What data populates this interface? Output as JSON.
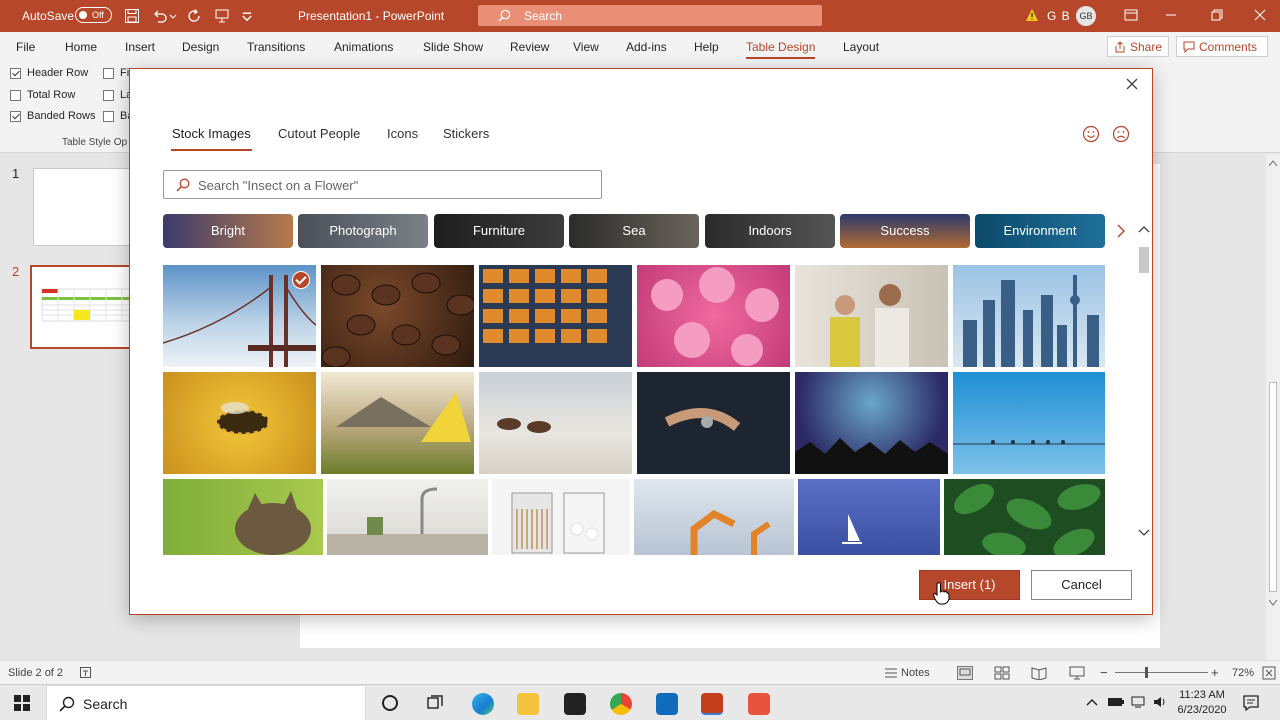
{
  "titlebar": {
    "autosave_label": "AutoSave",
    "autosave_state": "Off",
    "doc_title": "Presentation1 - PowerPoint",
    "search_placeholder": "Search",
    "user_initials": "G B",
    "avatar_initials": "GB"
  },
  "ribbon_tabs": [
    "File",
    "Home",
    "Insert",
    "Design",
    "Transitions",
    "Animations",
    "Slide Show",
    "Review",
    "View",
    "Add-ins",
    "Help",
    "Table Design",
    "Layout"
  ],
  "active_ribbon_tab": "Table Design",
  "share_label": "Share",
  "comments_label": "Comments",
  "table_style_options": {
    "header_row": "Header Row",
    "total_row": "Total Row",
    "banded_rows": "Banded Rows",
    "first_col_partial": "Fi",
    "last_col_partial": "La",
    "banded_col_partial": "Ba",
    "group_label": "Table Style Op"
  },
  "slides": {
    "numbers": [
      "1",
      "2"
    ],
    "selected": "2"
  },
  "dialog": {
    "tabs": [
      "Stock Images",
      "Cutout People",
      "Icons",
      "Stickers"
    ],
    "active_tab": "Stock Images",
    "search_placeholder": "Search \"Insect on a Flower\"",
    "categories": [
      "Bright",
      "Photograph",
      "Furniture",
      "Sea",
      "Indoors",
      "Success",
      "Environment"
    ],
    "images": [
      "golden-gate-bridge",
      "coffee-beans",
      "building-facade",
      "pink-flowers",
      "office-team",
      "city-skyline",
      "bee-honeycomb",
      "camping-tent",
      "horses-beach",
      "businessman-watch",
      "concert-crowd",
      "birds-on-wire",
      "cat",
      "kitchen",
      "bathroom-jars",
      "factory-robots",
      "sailboat",
      "green-leaves"
    ],
    "selected_image": "golden-gate-bridge",
    "insert_label": "Insert (1)",
    "cancel_label": "Cancel"
  },
  "status": {
    "slide_info": "Slide 2 of 2",
    "notes_label": "Notes",
    "zoom": "72%"
  },
  "taskbar": {
    "search_label": "Search",
    "time": "11:23 AM",
    "date": "6/23/2020"
  },
  "colors": {
    "accent": "#b7472a"
  }
}
